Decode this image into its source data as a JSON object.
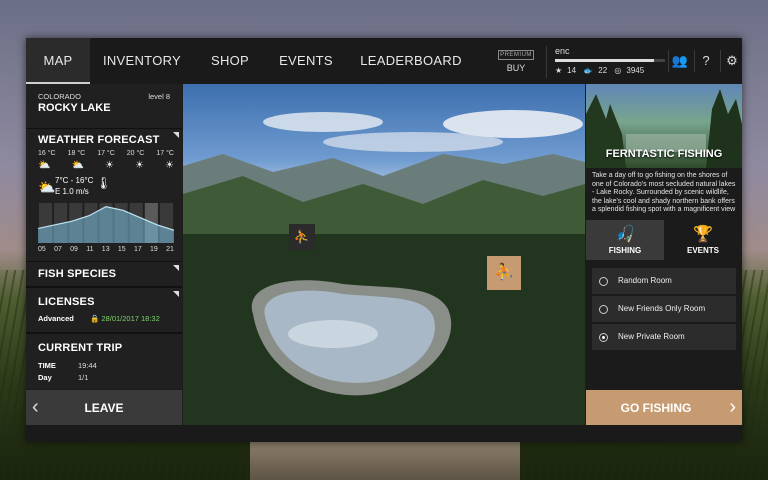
{
  "nav": {
    "tabs": [
      {
        "label": "MAP",
        "active": true
      },
      {
        "label": "INVENTORY",
        "active": false
      },
      {
        "label": "SHOP",
        "active": false
      },
      {
        "label": "EVENTS",
        "active": false
      },
      {
        "label": "LEADERBOARD",
        "active": false
      }
    ]
  },
  "premium": {
    "badge": "PREMIUM",
    "buy": "BUY"
  },
  "player": {
    "name": "enc",
    "xp_fraction": 0.9,
    "stars": "14",
    "fish": "22",
    "coins": "3945"
  },
  "location": {
    "region": "COLORADO",
    "level": "level 8",
    "lake": "ROCKY LAKE"
  },
  "forecast": {
    "title": "WEATHER FORECAST",
    "temps": [
      "16 °C",
      "18 °C",
      "17 °C",
      "20 °C",
      "17 °C"
    ],
    "icons": [
      "partly-cloudy-icon",
      "partly-cloudy-icon",
      "sun-icon",
      "sun-icon",
      "sun-icon"
    ],
    "current_temp": "7°C - 16°C",
    "wind": "E 1.0 m/s",
    "hours": [
      "05",
      "07",
      "09",
      "11",
      "13",
      "15",
      "17",
      "19",
      "21"
    ],
    "curve": [
      8,
      10,
      12,
      15,
      20,
      18,
      14,
      10,
      7
    ]
  },
  "fish_species": {
    "title": "FISH SPECIES"
  },
  "licenses": {
    "title": "LICENSES",
    "type": "Advanced",
    "expires": "28/01/2017 18:32"
  },
  "trip": {
    "title": "CURRENT TRIP",
    "time_label": "TIME",
    "time_value": "19:44",
    "day_label": "Day",
    "day_value": "1/1"
  },
  "leave": {
    "label": "LEAVE"
  },
  "promo": {
    "title": "FERNTASTIC FISHING",
    "description": "Take a day off to go fishing on the shores of one of Colorado's most secluded natural lakes - Lake Rocky. Surrounded by scenic wildlife, the lake's cool and shady northern bank offers a splendid fishing spot with a magnificent view"
  },
  "right_tabs": [
    {
      "label": "FISHING",
      "active": true
    },
    {
      "label": "EVENTS",
      "active": false
    }
  ],
  "rooms": [
    {
      "label": "Random Room",
      "selected": false
    },
    {
      "label": "New Friends Only Room",
      "selected": false
    },
    {
      "label": "New Private Room",
      "selected": true
    }
  ],
  "go": {
    "label": "GO FISHING"
  },
  "colors": {
    "accent": "#c79b72",
    "panel": "#1b1b1b",
    "license_date": "#7fd36b"
  }
}
